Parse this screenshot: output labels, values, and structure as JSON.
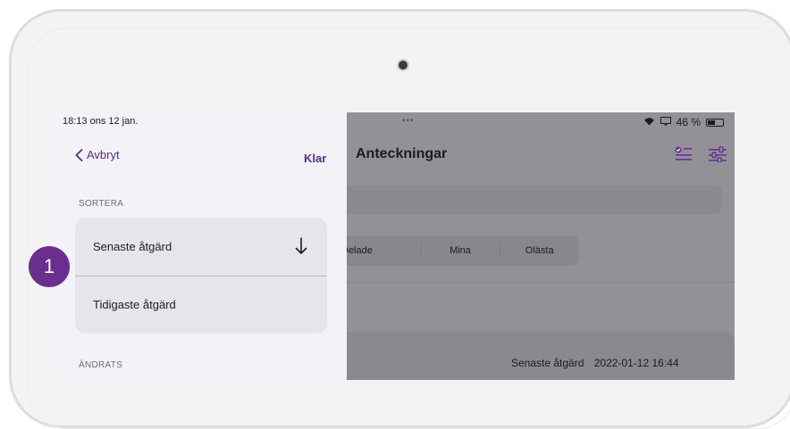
{
  "status": {
    "time": "18:13  ons 12 jan.",
    "battery": "46 %",
    "dots": "•••"
  },
  "sheet": {
    "cancel_label": "Avbryt",
    "done_label": "Klar",
    "sort_header": "SORTERA",
    "options": [
      "Senaste åtgärd",
      "Tidigaste åtgärd"
    ],
    "selected_index": 0,
    "changed_header": "ÄNDRATS"
  },
  "app": {
    "title": "Anteckningar",
    "segments": [
      "Delade",
      "Mina",
      "Olästa"
    ],
    "card_meta": {
      "label": "Senaste åtgärd",
      "value": "2022-01-12 16:44"
    }
  },
  "marker": {
    "number": "1",
    "color": "#6b2e8f"
  },
  "colors": {
    "accent": "#5b2a86",
    "icon_purple": "#6a2f9a"
  }
}
